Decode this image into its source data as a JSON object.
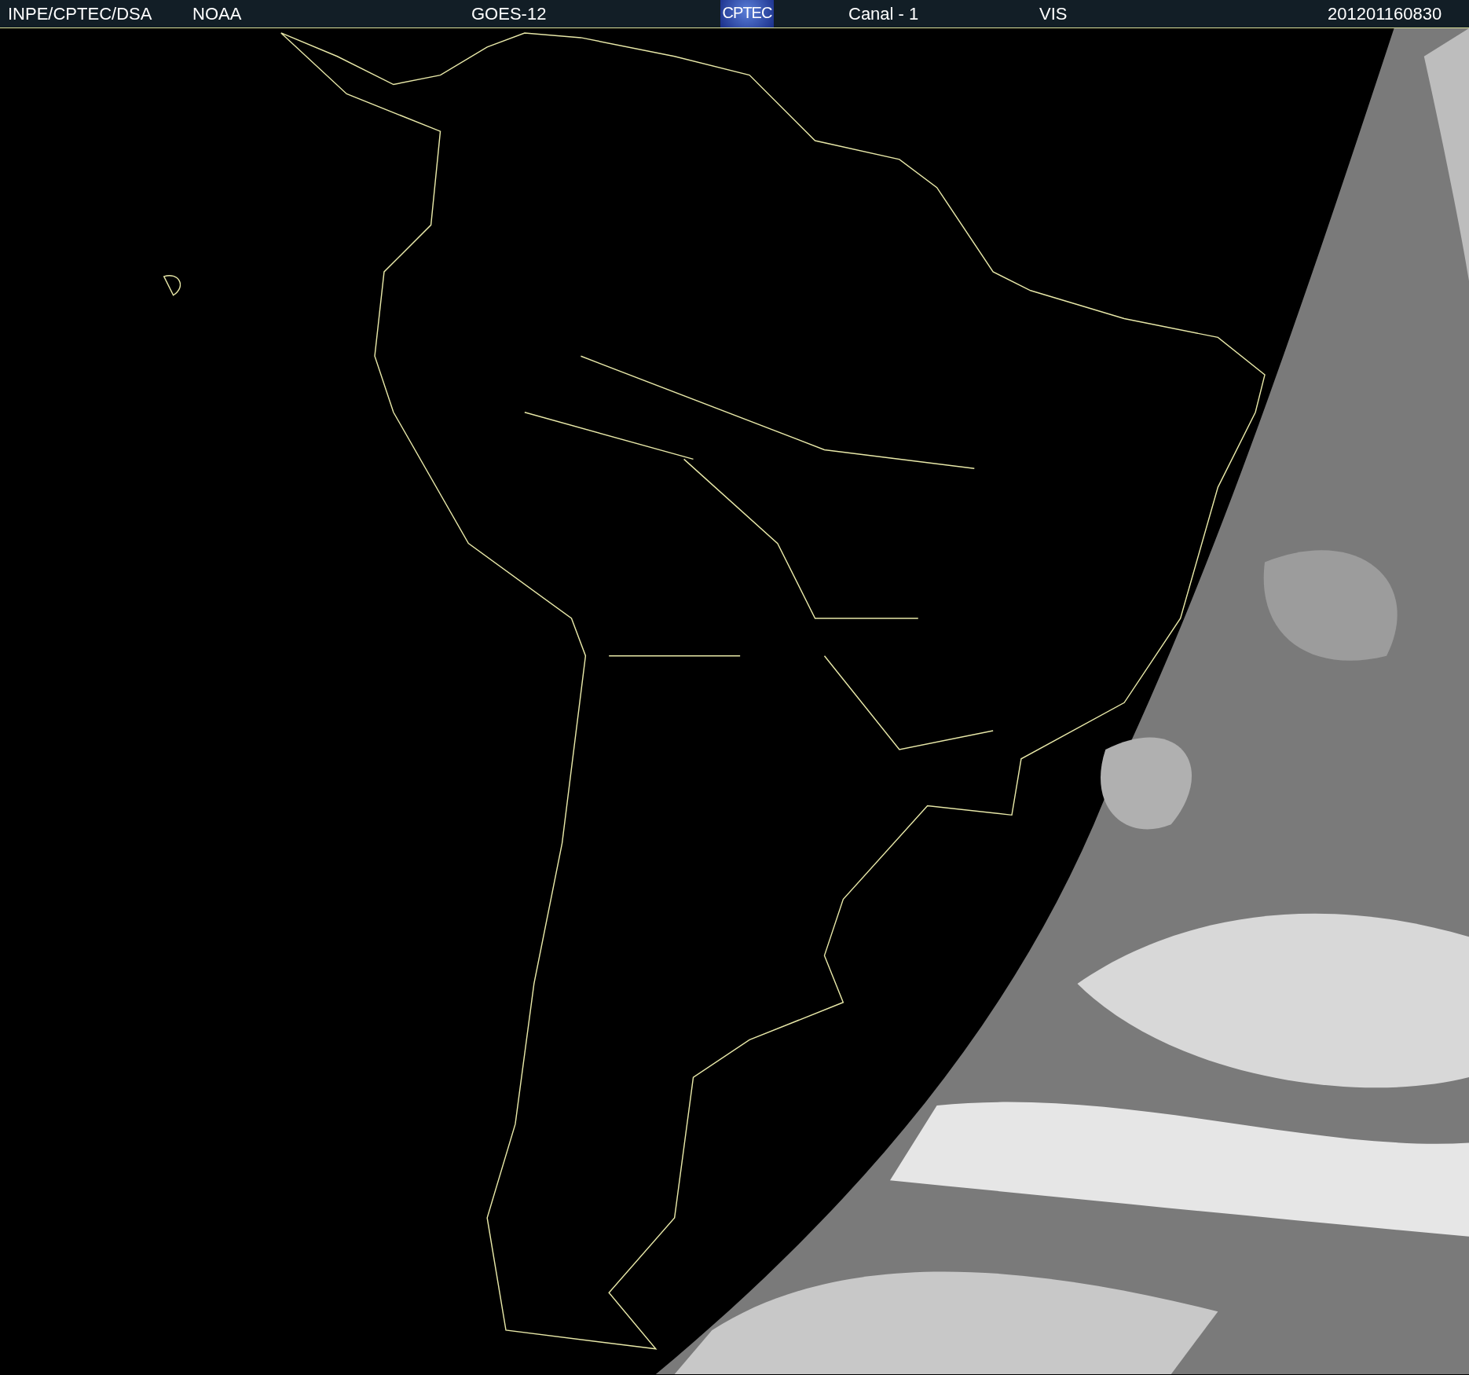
{
  "header": {
    "source": "INPE/CPTEC/DSA",
    "agency": "NOAA",
    "satellite": "GOES-12",
    "logo": "CPTEC",
    "channel": "Canal - 1",
    "band": "VIS",
    "timestamp": "201201160830"
  }
}
